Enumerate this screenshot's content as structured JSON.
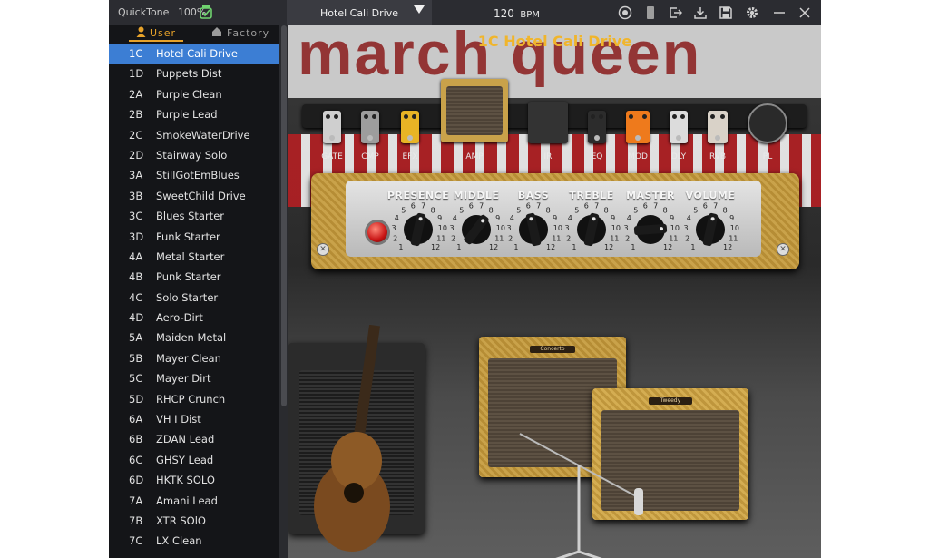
{
  "topbar": {
    "app_name": "QuickTone",
    "battery": "100%",
    "preset_selected": "Hotel Cali Drive",
    "bpm_value": "120",
    "bpm_unit": "BPM"
  },
  "tabs": {
    "user": "User",
    "factory": "Factory"
  },
  "presets": [
    {
      "id": "1C",
      "name": "Hotel Cali Drive",
      "selected": true
    },
    {
      "id": "1D",
      "name": "Puppets Dist"
    },
    {
      "id": "2A",
      "name": "Purple Clean"
    },
    {
      "id": "2B",
      "name": "Purple Lead"
    },
    {
      "id": "2C",
      "name": "SmokeWaterDrive"
    },
    {
      "id": "2D",
      "name": "Stairway Solo"
    },
    {
      "id": "3A",
      "name": "StillGotEmBlues"
    },
    {
      "id": "3B",
      "name": "SweetChild Drive"
    },
    {
      "id": "3C",
      "name": "Blues Starter"
    },
    {
      "id": "3D",
      "name": "Funk Starter"
    },
    {
      "id": "4A",
      "name": "Metal Starter"
    },
    {
      "id": "4B",
      "name": "Punk Starter"
    },
    {
      "id": "4C",
      "name": "Solo Starter"
    },
    {
      "id": "4D",
      "name": "Aero-Dirt"
    },
    {
      "id": "5A",
      "name": "Maiden Metal"
    },
    {
      "id": "5B",
      "name": "Mayer Clean"
    },
    {
      "id": "5C",
      "name": "Mayer Dirt"
    },
    {
      "id": "5D",
      "name": "RHCP Crunch"
    },
    {
      "id": "6A",
      "name": "VH I Dist"
    },
    {
      "id": "6B",
      "name": "ZDAN    Lead"
    },
    {
      "id": "6C",
      "name": "GHSY    Lead"
    },
    {
      "id": "6D",
      "name": "HKTK  SOLO"
    },
    {
      "id": "7A",
      "name": "Amani   Lead"
    },
    {
      "id": "7B",
      "name": "XTR  SOlO"
    },
    {
      "id": "7C",
      "name": "LX  Clean"
    }
  ],
  "preset_title": "1C Hotel Cali Drive",
  "banner_text": "march queen",
  "chain": [
    {
      "label": "GATE",
      "color": "#cfcfcf"
    },
    {
      "label": "CMP",
      "color": "#9d9d9d"
    },
    {
      "label": "EFX",
      "color": "#e8b425"
    },
    {
      "label": "AMP",
      "color": "#c9a24a"
    },
    {
      "label": "IR",
      "color": "#333333"
    },
    {
      "label": "EQ",
      "color": "#2c2c2c"
    },
    {
      "label": "MOD",
      "color": "#ee7a1c"
    },
    {
      "label": "DLY",
      "color": "#dcdcdc"
    },
    {
      "label": "RVB",
      "color": "#d9d2c8"
    },
    {
      "label": "PL",
      "color": "#2a2a2a"
    }
  ],
  "knobs": [
    {
      "label": "PRESENCE",
      "value": 7
    },
    {
      "label": "MIDDLE",
      "value": 8
    },
    {
      "label": "BASS",
      "value": 6
    },
    {
      "label": "TREBLE",
      "value": 7
    },
    {
      "label": "MASTER",
      "value": 10
    },
    {
      "label": "VOLUME",
      "value": 7
    }
  ],
  "dial_numbers": [
    "1",
    "2",
    "3",
    "4",
    "5",
    "6",
    "7",
    "8",
    "9",
    "10",
    "11",
    "12"
  ],
  "amp_logo_1": "Concerto",
  "amp_logo_2": "Tweedy"
}
